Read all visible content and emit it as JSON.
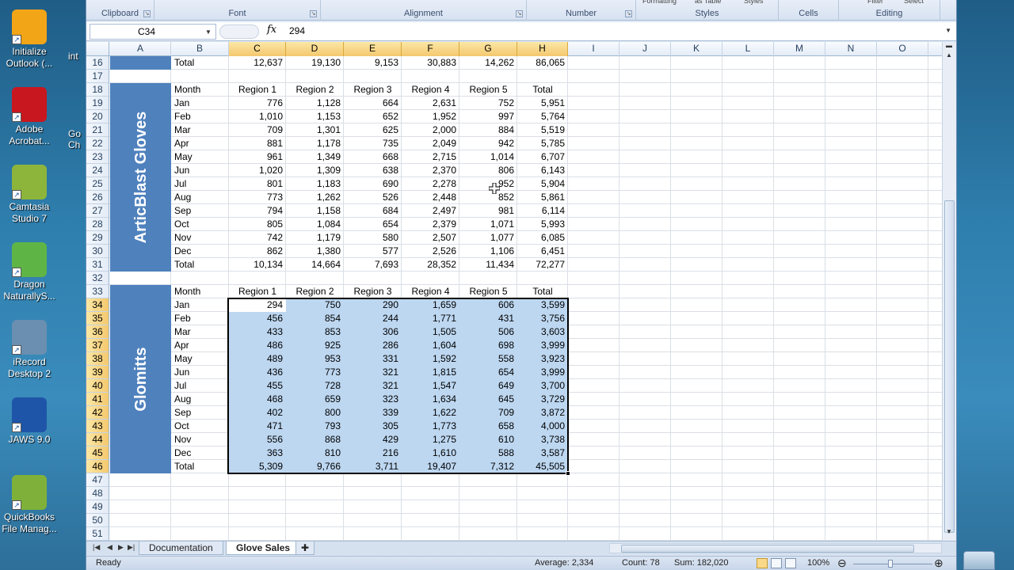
{
  "desktop": {
    "icons": [
      {
        "label": "Initialize Outlook (...",
        "icon": "outlook-icon",
        "color": "#f2a516"
      },
      {
        "label": "Adobe Acrobat...",
        "icon": "acrobat-icon",
        "color": "#c8171e"
      },
      {
        "label": "Camtasia Studio 7",
        "icon": "camtasia-icon",
        "color": "#8db53c"
      },
      {
        "label": "Dragon NaturallyS...",
        "icon": "dragon-icon",
        "color": "#5eb546"
      },
      {
        "label": "iRecord Desktop 2",
        "icon": "irecord-icon",
        "color": "#6a8fb0"
      },
      {
        "label": "JAWS 9.0",
        "icon": "jaws-icon",
        "color": "#1f55a8"
      },
      {
        "label": "QuickBooks File Manag...",
        "icon": "quickbooks-icon",
        "color": "#7fb13a"
      }
    ],
    "strip": [
      "int",
      "Go",
      "Ch"
    ]
  },
  "ribbon": {
    "groups": [
      "Clipboard",
      "Font",
      "Alignment",
      "Number",
      "Styles",
      "Cells",
      "Editing"
    ],
    "styles_items": [
      "Formatting",
      "as Table",
      "Styles"
    ],
    "editing_items": [
      "Filter",
      "Select"
    ]
  },
  "formula_bar": {
    "name_box": "C34",
    "fx": "fx",
    "formula": "294"
  },
  "columns": [
    "A",
    "B",
    "C",
    "D",
    "E",
    "F",
    "G",
    "H",
    "I",
    "J",
    "K",
    "L",
    "M",
    "N",
    "O"
  ],
  "rows": [
    16,
    17,
    18,
    19,
    20,
    21,
    22,
    23,
    24,
    25,
    26,
    27,
    28,
    29,
    30,
    31,
    32,
    33,
    34,
    35,
    36,
    37,
    38,
    39,
    40,
    41,
    42,
    43,
    44,
    45,
    46,
    47,
    48,
    49,
    50,
    51
  ],
  "section_top": {
    "total_row": {
      "label": "Total",
      "values": [
        "12,637",
        "19,130",
        "9,153",
        "30,883",
        "14,262",
        "86,065"
      ]
    }
  },
  "section_articblast": {
    "band_label": "ArticBlast Gloves",
    "header": [
      "Month",
      "Region 1",
      "Region 2",
      "Region 3",
      "Region 4",
      "Region 5",
      "Total"
    ],
    "rows": [
      [
        "Jan",
        "776",
        "1,128",
        "664",
        "2,631",
        "752",
        "5,951"
      ],
      [
        "Feb",
        "1,010",
        "1,153",
        "652",
        "1,952",
        "997",
        "5,764"
      ],
      [
        "Mar",
        "709",
        "1,301",
        "625",
        "2,000",
        "884",
        "5,519"
      ],
      [
        "Apr",
        "881",
        "1,178",
        "735",
        "2,049",
        "942",
        "5,785"
      ],
      [
        "May",
        "961",
        "1,349",
        "668",
        "2,715",
        "1,014",
        "6,707"
      ],
      [
        "Jun",
        "1,020",
        "1,309",
        "638",
        "2,370",
        "806",
        "6,143"
      ],
      [
        "Jul",
        "801",
        "1,183",
        "690",
        "2,278",
        "952",
        "5,904"
      ],
      [
        "Aug",
        "773",
        "1,262",
        "526",
        "2,448",
        "852",
        "5,861"
      ],
      [
        "Sep",
        "794",
        "1,158",
        "684",
        "2,497",
        "981",
        "6,114"
      ],
      [
        "Oct",
        "805",
        "1,084",
        "654",
        "2,379",
        "1,071",
        "5,993"
      ],
      [
        "Nov",
        "742",
        "1,179",
        "580",
        "2,507",
        "1,077",
        "6,085"
      ],
      [
        "Dec",
        "862",
        "1,380",
        "577",
        "2,526",
        "1,106",
        "6,451"
      ],
      [
        "Total",
        "10,134",
        "14,664",
        "7,693",
        "28,352",
        "11,434",
        "72,277"
      ]
    ]
  },
  "section_glomitts": {
    "band_label": "Glomitts",
    "header": [
      "Month",
      "Region 1",
      "Region 2",
      "Region 3",
      "Region 4",
      "Region 5",
      "Total"
    ],
    "rows": [
      [
        "Jan",
        "294",
        "750",
        "290",
        "1,659",
        "606",
        "3,599"
      ],
      [
        "Feb",
        "456",
        "854",
        "244",
        "1,771",
        "431",
        "3,756"
      ],
      [
        "Mar",
        "433",
        "853",
        "306",
        "1,505",
        "506",
        "3,603"
      ],
      [
        "Apr",
        "486",
        "925",
        "286",
        "1,604",
        "698",
        "3,999"
      ],
      [
        "May",
        "489",
        "953",
        "331",
        "1,592",
        "558",
        "3,923"
      ],
      [
        "Jun",
        "436",
        "773",
        "321",
        "1,815",
        "654",
        "3,999"
      ],
      [
        "Jul",
        "455",
        "728",
        "321",
        "1,547",
        "649",
        "3,700"
      ],
      [
        "Aug",
        "468",
        "659",
        "323",
        "1,634",
        "645",
        "3,729"
      ],
      [
        "Sep",
        "402",
        "800",
        "339",
        "1,622",
        "709",
        "3,872"
      ],
      [
        "Oct",
        "471",
        "793",
        "305",
        "1,773",
        "658",
        "4,000"
      ],
      [
        "Nov",
        "556",
        "868",
        "429",
        "1,275",
        "610",
        "3,738"
      ],
      [
        "Dec",
        "363",
        "810",
        "216",
        "1,610",
        "588",
        "3,587"
      ],
      [
        "Total",
        "5,309",
        "9,766",
        "3,711",
        "19,407",
        "7,312",
        "45,505"
      ]
    ]
  },
  "sheet_tabs": [
    {
      "label": "Documentation",
      "active": false
    },
    {
      "label": "Glove Sales",
      "active": true
    }
  ],
  "status": {
    "ready": "Ready",
    "average": "Average:  2,334",
    "count": "Count: 78",
    "sum": "Sum: 182,020",
    "zoom": "100%"
  },
  "colors": {
    "band": "#4f81bd",
    "selection": "#bdd7f1",
    "header_highlight": "#f4c86e"
  }
}
